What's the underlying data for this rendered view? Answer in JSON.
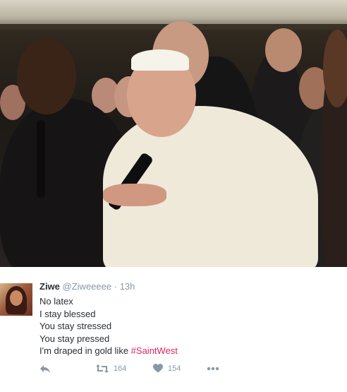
{
  "photo": {
    "alt_subject": "pope-with-microphone"
  },
  "tweet": {
    "author_name": "Ziwe",
    "author_handle": "@Ziweeeee",
    "separator": "·",
    "time": "13h",
    "lines": [
      "No latex",
      "I stay blessed",
      "You stay stressed",
      "You stay pressed",
      "I'm draped in gold like "
    ],
    "hashtag": "#SaintWest",
    "actions": {
      "reply_icon": "reply-icon",
      "retweet_icon": "retweet-icon",
      "retweet_count": "164",
      "like_icon": "heart-icon",
      "like_count": "154",
      "more_icon": "more-icon"
    }
  },
  "colors": {
    "hashtag": "#e0245e",
    "meta_gray": "#8899a6",
    "text": "#292f33"
  }
}
